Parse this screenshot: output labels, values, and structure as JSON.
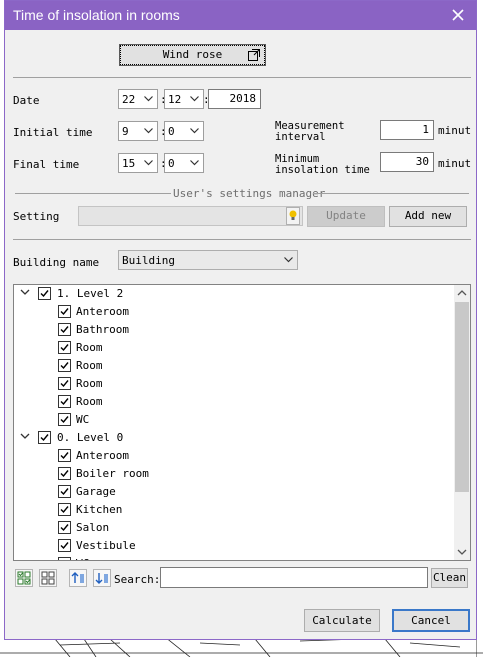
{
  "dialog": {
    "title": "Time of insolation in rooms"
  },
  "wind_rose": {
    "label": "Wind rose"
  },
  "date": {
    "label": "Date",
    "day": "22",
    "month": "12",
    "year": "2018",
    "separator": ":"
  },
  "initial_time": {
    "label": "Initial time",
    "hour": "9",
    "minute": "0",
    "separator": ":"
  },
  "final_time": {
    "label": "Final time",
    "hour": "15",
    "minute": "0",
    "separator": ":"
  },
  "measurement_interval": {
    "label_line1": "Measurement",
    "label_line2": "interval",
    "value": "1",
    "unit": "minut"
  },
  "minimum_insolation": {
    "label_line1": "Minimum",
    "label_line2": "insolation time",
    "value": "30",
    "unit": "minut"
  },
  "settings_manager": {
    "title": "User's settings manager",
    "setting_label": "Setting",
    "setting_value": "",
    "update_label": "Update",
    "add_new_label": "Add new"
  },
  "building": {
    "label": "Building name",
    "value": "Building"
  },
  "tree": {
    "groups": [
      {
        "label": "1. Level 2",
        "checked": true,
        "expanded": true,
        "items": [
          "Anteroom",
          "Bathroom",
          "Room",
          "Room",
          "Room",
          "Room",
          "WC"
        ]
      },
      {
        "label": "0. Level 0",
        "checked": true,
        "expanded": true,
        "items": [
          "Anteroom",
          "Boiler room",
          "Garage",
          "Kitchen",
          "Salon",
          "Vestibule",
          "WC"
        ]
      }
    ]
  },
  "search": {
    "label": "Search:",
    "value": "",
    "clean_label": "Clean"
  },
  "footer": {
    "calculate_label": "Calculate",
    "cancel_label": "Cancel"
  },
  "colors": {
    "title_bar": "#8a63c4",
    "accent_border": "#3a78c9",
    "bulb": "#f0c000"
  }
}
